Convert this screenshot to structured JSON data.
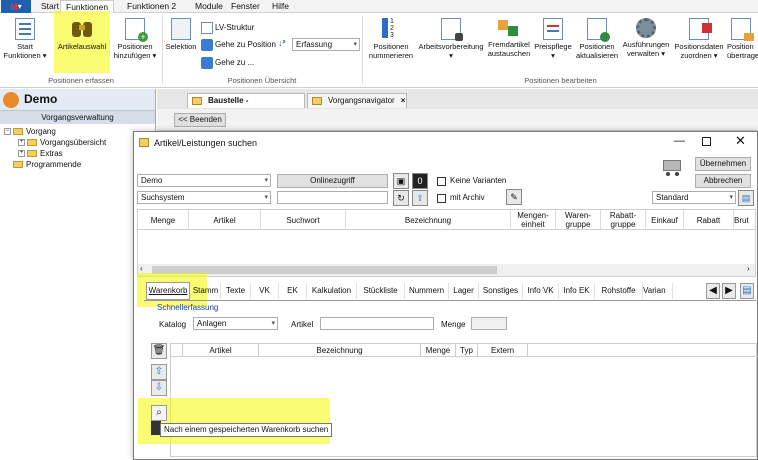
{
  "menubar": {
    "tabs": [
      "Start",
      "Funktionen",
      "Funktionen 2",
      "Module",
      "Fenster",
      "Hilfe"
    ],
    "active": "Funktionen"
  },
  "ribbon": {
    "start_funktionen": "Start\nFunktionen ▾",
    "artikelauswahl": "Artikelauswahl",
    "positionen_hinzufuegen": "Positionen\nhinzufügen ▾",
    "group1": "Positionen erfassen",
    "selektion": "Selektion",
    "lv_struktur": "LV-Struktur",
    "gehe_zu_position": "Gehe zu Position",
    "gehe_zu": "Gehe zu ...",
    "erfassung": "Erfassung",
    "group2": "Positionen Übersicht",
    "positionen_nummerieren": "Positionen\nnummerieren",
    "arbeitsvorbereitung": "Arbeitsvorbereitung\n▾",
    "fremdartikel": "Fremdartikel\naustauschen",
    "preispflege": "Preispflege\n▾",
    "positionen_aktualisieren": "Positionen\naktualisieren",
    "ausfuehrungen": "Ausführungen\nverwalten ▾",
    "positionsdaten": "Positionsdaten\nzuordnen ▾",
    "positionen_uebertragen": "Position\nübertrage",
    "group3": "Positionen bearbeiten"
  },
  "left": {
    "title": "Demo",
    "subtitle": "Vorgangsverwaltung",
    "tree": [
      "Vorgang",
      "Vorgangsübersicht",
      "Extras",
      "Programmende"
    ]
  },
  "doctabs": {
    "beenden": "<< Beenden",
    "tab1": "Baustelle - Positionen",
    "tab2": "Vorgangsnavigator"
  },
  "dialog": {
    "title": "Artikel/Leistungen suchen",
    "combo_demo": "Demo",
    "combo_suchsystem": "Suchsystem",
    "onlinezugriff": "Onlinezugriff",
    "keine_varianten": "Keine Varianten",
    "mit_archiv": "mit Archiv",
    "uebernehmen": "Übernehmen",
    "abbrechen": "Abbrechen",
    "standard": "Standard",
    "columns": [
      "Menge",
      "Artikel",
      "Suchwort",
      "Bezeichnung",
      "Mengen-\neinheit",
      "Waren-\ngruppe",
      "Rabatt-\ngruppe",
      "Einkauf",
      "Rabatt",
      "Brut"
    ],
    "tabs": [
      "Warenkorb",
      "Stamm",
      "Texte",
      "VK",
      "EK",
      "Kalkulation",
      "Stückliste",
      "Nummern",
      "Lager",
      "Sonstiges",
      "Info VK",
      "Info EK",
      "Rohstoffe",
      "Varian"
    ],
    "schnellerfassung": "Schnellerfassung",
    "katalog_label": "Katalog",
    "katalog_value": "Anlagen",
    "artikel_label": "Artikel",
    "menge_label": "Menge",
    "basket_columns": [
      "Artikel",
      "Bezeichnung",
      "Menge",
      "Typ",
      "Extern"
    ],
    "tooltip": "Nach einem gespeicherten Warenkorb suchen"
  },
  "colors": {
    "highlight": "#f4f700",
    "accent": "#1f5fb0"
  }
}
